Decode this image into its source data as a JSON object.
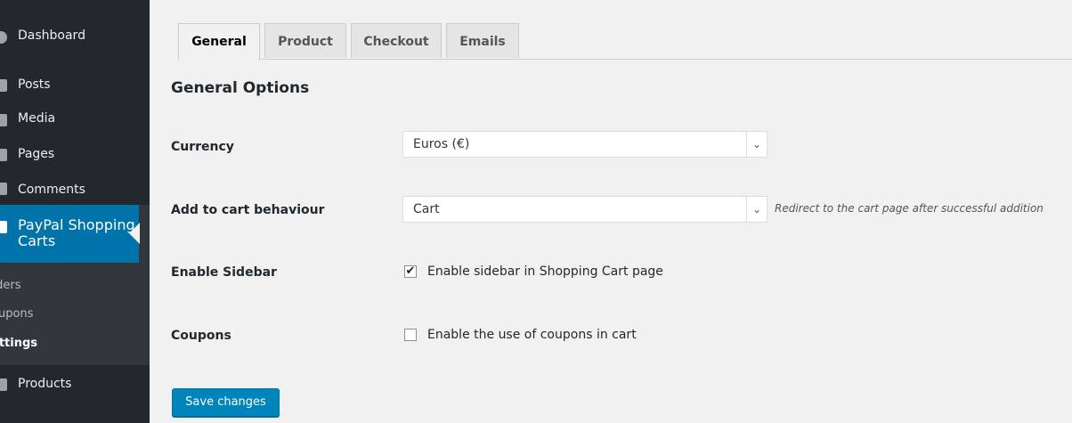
{
  "sidebar": {
    "items": [
      {
        "label": "Dashboard",
        "icon": "dashboard-icon"
      },
      {
        "label": "Posts",
        "icon": "pin-icon"
      },
      {
        "label": "Media",
        "icon": "media-icon"
      },
      {
        "label": "Pages",
        "icon": "pages-icon"
      },
      {
        "label": "Comments",
        "icon": "comments-icon"
      }
    ],
    "active_item": {
      "label": "PayPal Shopping Carts",
      "icon": "cart-icon"
    },
    "submenu": [
      {
        "label": "rders"
      },
      {
        "label": "oupons"
      },
      {
        "label": "ettings"
      }
    ],
    "after_item": {
      "label": "Products",
      "icon": "pin-icon"
    },
    "colors": {
      "background": "#23282d",
      "active": "#0073aa"
    }
  },
  "tabs": [
    {
      "label": "General",
      "active": true
    },
    {
      "label": "Product",
      "active": false
    },
    {
      "label": "Checkout",
      "active": false
    },
    {
      "label": "Emails",
      "active": false
    }
  ],
  "section_title": "General Options",
  "settings": {
    "currency": {
      "label": "Currency",
      "value": "Euros (€)"
    },
    "add_to_cart": {
      "label": "Add to cart behaviour",
      "value": "Cart",
      "hint": "Redirect to the cart page after successful addition"
    },
    "enable_sidebar": {
      "label": "Enable Sidebar",
      "checkbox_label": "Enable sidebar in Shopping Cart page",
      "checked": true
    },
    "coupons": {
      "label": "Coupons",
      "checkbox_label": "Enable the use of coupons in cart",
      "checked": false
    }
  },
  "save_button": "Save changes"
}
